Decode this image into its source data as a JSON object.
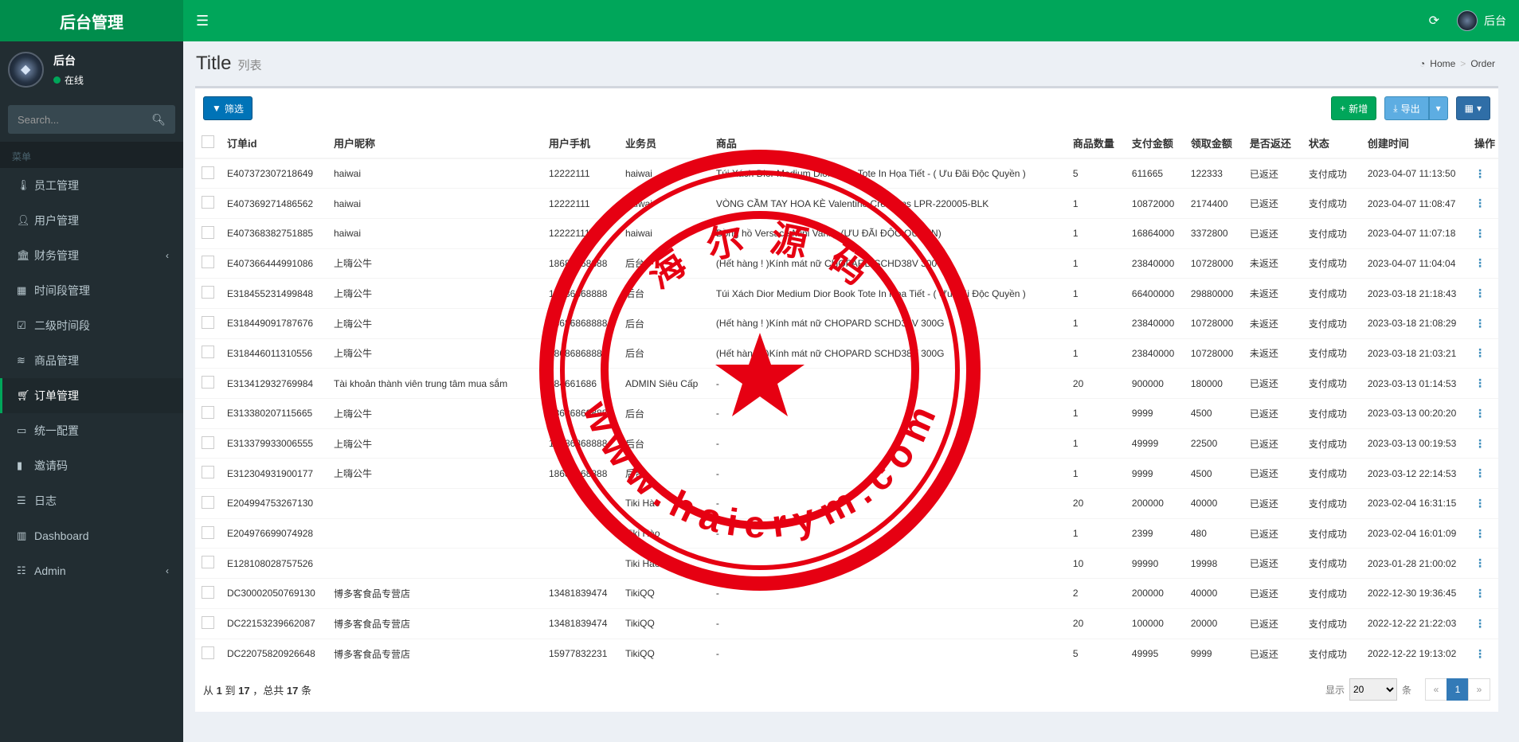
{
  "app": {
    "logo": "后台管理"
  },
  "header": {
    "user_name": "后台"
  },
  "sidebar": {
    "user_name": "后台",
    "status": "在线",
    "search_placeholder": "Search...",
    "section": "菜单",
    "items": [
      {
        "label": "员工管理",
        "icon": "thermometer-icon"
      },
      {
        "label": "用户管理",
        "icon": "user-icon"
      },
      {
        "label": "财务管理",
        "icon": "bank-icon",
        "arrow": true
      },
      {
        "label": "时间段管理",
        "icon": "calendar-icon"
      },
      {
        "label": "二级时间段",
        "icon": "calendar-check-icon"
      },
      {
        "label": "商品管理",
        "icon": "database-icon"
      },
      {
        "label": "订单管理",
        "icon": "cart-icon",
        "active": true
      },
      {
        "label": "统一配置",
        "icon": "desktop-icon"
      },
      {
        "label": "邀请码",
        "icon": "book-icon"
      },
      {
        "label": "日志",
        "icon": "list-icon"
      },
      {
        "label": "Dashboard",
        "icon": "bar-chart-icon"
      },
      {
        "label": "Admin",
        "icon": "list-alt-icon",
        "arrow": true
      }
    ]
  },
  "page": {
    "title": "Title",
    "subtitle": "列表",
    "breadcrumb": [
      "Home",
      "Order"
    ]
  },
  "toolbar": {
    "filter": "筛选",
    "add": "新增",
    "export": "导出"
  },
  "table": {
    "columns": [
      "订单id",
      "用户昵称",
      "用户手机",
      "业务员",
      "商品",
      "商品数量",
      "支付金额",
      "领取金额",
      "是否返还",
      "状态",
      "创建时间",
      "操作"
    ],
    "rows": [
      [
        "E407372307218649",
        "haiwai",
        "12222111",
        "haiwai",
        "Túi Xách Dior Medium Dior Book Tote In Họa Tiết - ( Ưu Đãi Độc Quyền )",
        "5",
        "611665",
        "122333",
        "已返还",
        "支付成功",
        "2023-04-07 11:13:50"
      ],
      [
        "E407369271486562",
        "haiwai",
        "12222111",
        "haiwai",
        "VÒNG CẦM TAY HOA KÈ Valentino Creations LPR-220005-BLK",
        "1",
        "10872000",
        "2174400",
        "已返还",
        "支付成功",
        "2023-04-07 11:08:47"
      ],
      [
        "E407368382751885",
        "haiwai",
        "12222111",
        "haiwai",
        "Đồng hồ Versace Mini Vanity (ƯU ĐÃI ĐỘC QUYỀN)",
        "1",
        "16864000",
        "3372800",
        "已返还",
        "支付成功",
        "2023-04-07 11:07:18"
      ],
      [
        "E407366444991086",
        "上嗨公牛",
        "18686868888",
        "后台",
        "(Hết hàng ! )Kính mát nữ CHOPARD SCHD38V 300G",
        "1",
        "23840000",
        "10728000",
        "未返还",
        "支付成功",
        "2023-04-07 11:04:04"
      ],
      [
        "E318455231499848",
        "上嗨公牛",
        "18686868888",
        "后台",
        "Túi Xách Dior Medium Dior Book Tote In Họa Tiết - ( Ưu Đãi Độc Quyền )",
        "1",
        "66400000",
        "29880000",
        "未返还",
        "支付成功",
        "2023-03-18 21:18:43"
      ],
      [
        "E318449091787676",
        "上嗨公牛",
        "18686868888",
        "后台",
        "(Hết hàng ! )Kính mát nữ CHOPARD SCHD38V 300G",
        "1",
        "23840000",
        "10728000",
        "未返还",
        "支付成功",
        "2023-03-18 21:08:29"
      ],
      [
        "E318446011310556",
        "上嗨公牛",
        "18686868888",
        "后台",
        "(Hết hàng ! )Kính mát nữ CHOPARD SCHD38V 300G",
        "1",
        "23840000",
        "10728000",
        "未返还",
        "支付成功",
        "2023-03-18 21:03:21"
      ],
      [
        "E313412932769984",
        "Tài khoản thành viên trung tâm mua sắm",
        "984661686",
        "ADMIN Siêu Cấp",
        "-",
        "20",
        "900000",
        "180000",
        "已返还",
        "支付成功",
        "2023-03-13 01:14:53"
      ],
      [
        "E313380207115665",
        "上嗨公牛",
        "18686868888",
        "后台",
        "-",
        "1",
        "9999",
        "4500",
        "已返还",
        "支付成功",
        "2023-03-13 00:20:20"
      ],
      [
        "E313379933006555",
        "上嗨公牛",
        "18686868888",
        "后台",
        "-",
        "1",
        "49999",
        "22500",
        "已返还",
        "支付成功",
        "2023-03-13 00:19:53"
      ],
      [
        "E312304931900177",
        "上嗨公牛",
        "18686868888",
        "后台",
        "-",
        "1",
        "9999",
        "4500",
        "已返还",
        "支付成功",
        "2023-03-12 22:14:53"
      ],
      [
        "E204994753267130",
        "",
        "",
        "Tiki Hào",
        "-",
        "20",
        "200000",
        "40000",
        "已返还",
        "支付成功",
        "2023-02-04 16:31:15"
      ],
      [
        "E204976699074928",
        "",
        "",
        "Tiki Hào",
        "-",
        "1",
        "2399",
        "480",
        "已返还",
        "支付成功",
        "2023-02-04 16:01:09"
      ],
      [
        "E128108028757526",
        "",
        "",
        "Tiki Hào",
        "-",
        "10",
        "99990",
        "19998",
        "已返还",
        "支付成功",
        "2023-01-28 21:00:02"
      ],
      [
        "DC30002050769130",
        "博多客食品专营店",
        "13481839474",
        "TikiQQ",
        "-",
        "2",
        "200000",
        "40000",
        "已返还",
        "支付成功",
        "2022-12-30 19:36:45"
      ],
      [
        "DC22153239662087",
        "博多客食品专营店",
        "13481839474",
        "TikiQQ",
        "-",
        "20",
        "100000",
        "20000",
        "已返还",
        "支付成功",
        "2022-12-22 21:22:03"
      ],
      [
        "DC22075820926648",
        "博多客食品专营店",
        "15977832231",
        "TikiQQ",
        "-",
        "5",
        "49995",
        "9999",
        "已返还",
        "支付成功",
        "2022-12-22 19:13:02"
      ]
    ]
  },
  "pager": {
    "from_label": "从",
    "from": "1",
    "to_label": "到",
    "to": "17",
    "total_label": "，总共",
    "total": "17",
    "unit": "条",
    "show_label": "显示",
    "page_size": "20",
    "prev": "«",
    "current": "1",
    "next": "»"
  },
  "watermark": {
    "text_top": "海 尔 源 码",
    "text_bottom": "www.haierym.com"
  },
  "colors": {
    "header": "#00a65a",
    "logo_bg": "#008d4c",
    "sidebar": "#222d32",
    "stamp": "#e60012"
  }
}
